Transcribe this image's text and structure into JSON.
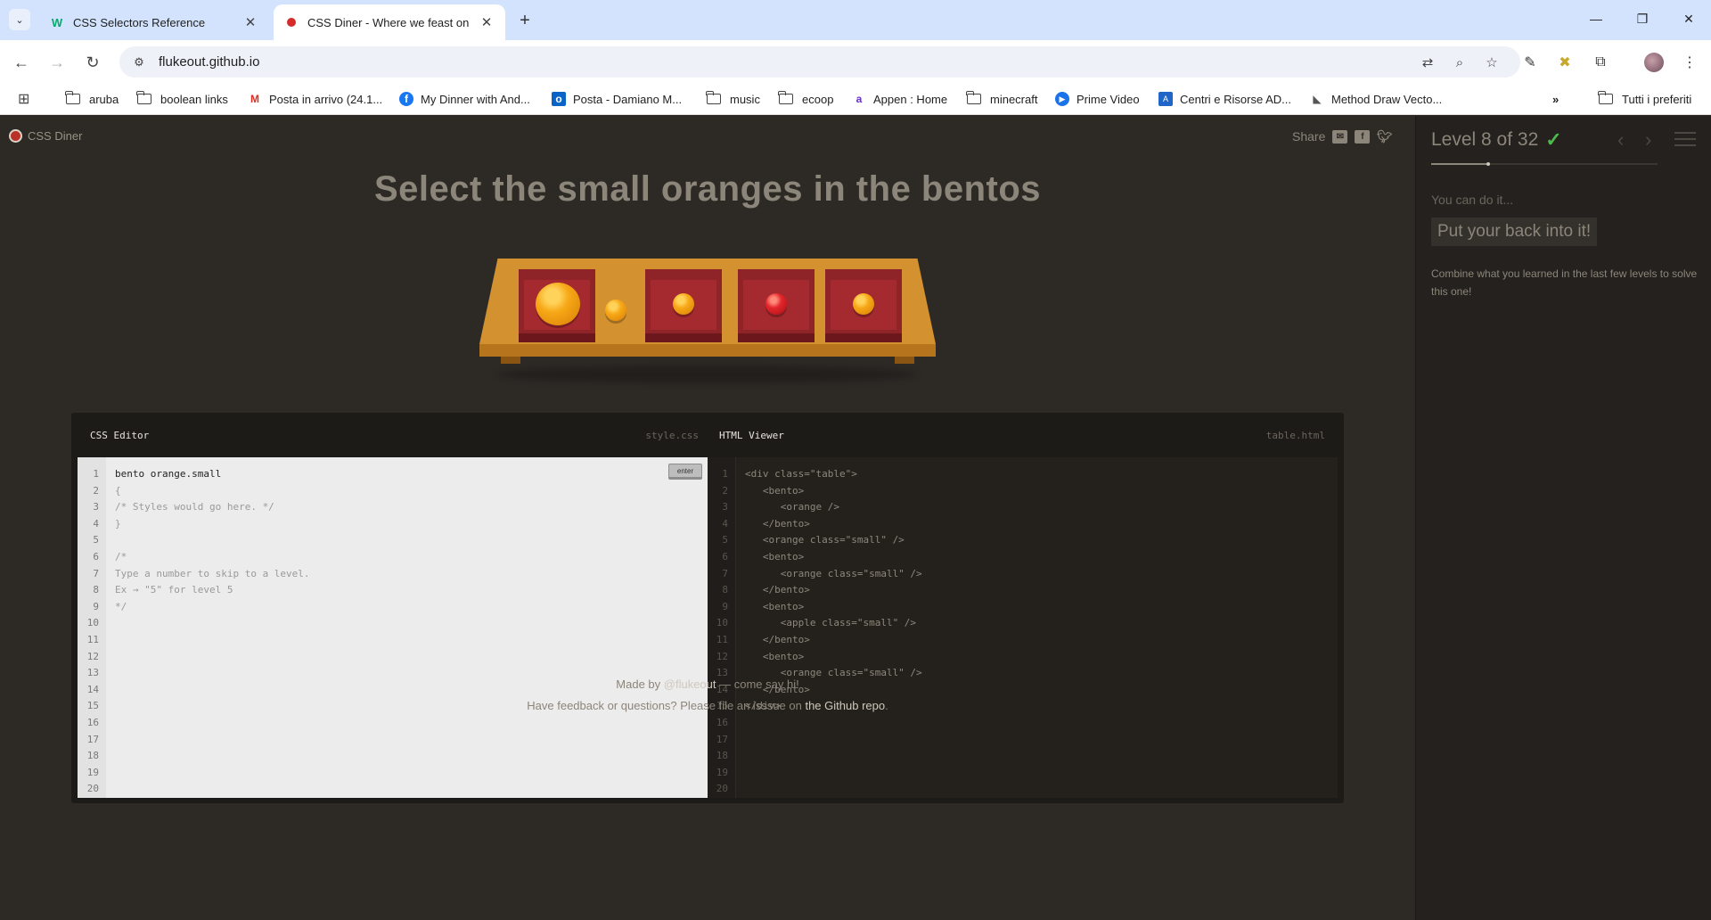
{
  "browser": {
    "tabs": [
      {
        "title": "CSS Selectors Reference",
        "favicon": "w3schools-icon",
        "active": false
      },
      {
        "title": "CSS Diner - Where we feast on",
        "favicon": "css-diner-icon",
        "active": true
      }
    ],
    "url": "flukeout.github.io",
    "bookmarks": [
      {
        "label": "aruba",
        "icon": "folder-icon"
      },
      {
        "label": "boolean links",
        "icon": "folder-icon"
      },
      {
        "label": "Posta in arrivo (24.1...",
        "icon": "gmail-icon"
      },
      {
        "label": "My Dinner with And...",
        "icon": "facebook-icon"
      },
      {
        "label": "Posta - Damiano M...",
        "icon": "outlook-icon"
      },
      {
        "label": "music",
        "icon": "folder-icon"
      },
      {
        "label": "ecoop",
        "icon": "folder-icon"
      },
      {
        "label": "Appen : Home",
        "icon": "appen-icon"
      },
      {
        "label": "minecraft",
        "icon": "folder-icon"
      },
      {
        "label": "Prime Video",
        "icon": "prime-video-icon"
      },
      {
        "label": "Centri e Risorse AD...",
        "icon": "adobe-icon"
      },
      {
        "label": "Method Draw Vecto...",
        "icon": "method-draw-icon"
      }
    ],
    "bookmarks_overflow": "»",
    "all_bookmarks_label": "Tutti i preferiti"
  },
  "game": {
    "logo": "CSS Diner",
    "share_label": "Share",
    "instruction": "Select the small oranges in the bentos",
    "css_editor": {
      "title": "CSS Editor",
      "filename": "style.css",
      "enter_label": "enter",
      "input_value": "bento orange.small",
      "lines": [
        "{",
        "/* Styles would go here. */",
        "}",
        "",
        "/*",
        "Type a number to skip to a level.",
        "Ex → \"5\" for level 5",
        "*/"
      ],
      "line_count": 20
    },
    "html_viewer": {
      "title": "HTML Viewer",
      "filename": "table.html",
      "lines": [
        "<div class=\"table\">",
        "   <bento>",
        "      <orange />",
        "   </bento>",
        "   <orange class=\"small\" />",
        "   <bento>",
        "      <orange class=\"small\" />",
        "   </bento>",
        "   <bento>",
        "      <apple class=\"small\" />",
        "   </bento>",
        "   <bento>",
        "      <orange class=\"small\" />",
        "   </bento>",
        "</div>"
      ],
      "line_count": 20
    },
    "footer": {
      "made_by_prefix": "Made by ",
      "made_by_link": "@flukeout",
      "made_by_suffix": " — come say hi!",
      "feedback_prefix": "Have feedback or questions? Please file an isssue on ",
      "feedback_link": "the Github repo",
      "feedback_suffix": "."
    }
  },
  "sidebar": {
    "level_title": "Level 8 of 32",
    "level_current": 8,
    "level_total": 32,
    "completed": true,
    "difficulty": "You can do it...",
    "selector_name": "Put your back into it!",
    "hint": "Combine what you learned in the last few levels to solve this one!"
  },
  "colors": {
    "page_bg": "#2d2a26",
    "sidebar_bg": "#24211e",
    "check_green": "#4cbb4c",
    "bento_red": "#8e2328",
    "table_wood": "#d3912f"
  }
}
